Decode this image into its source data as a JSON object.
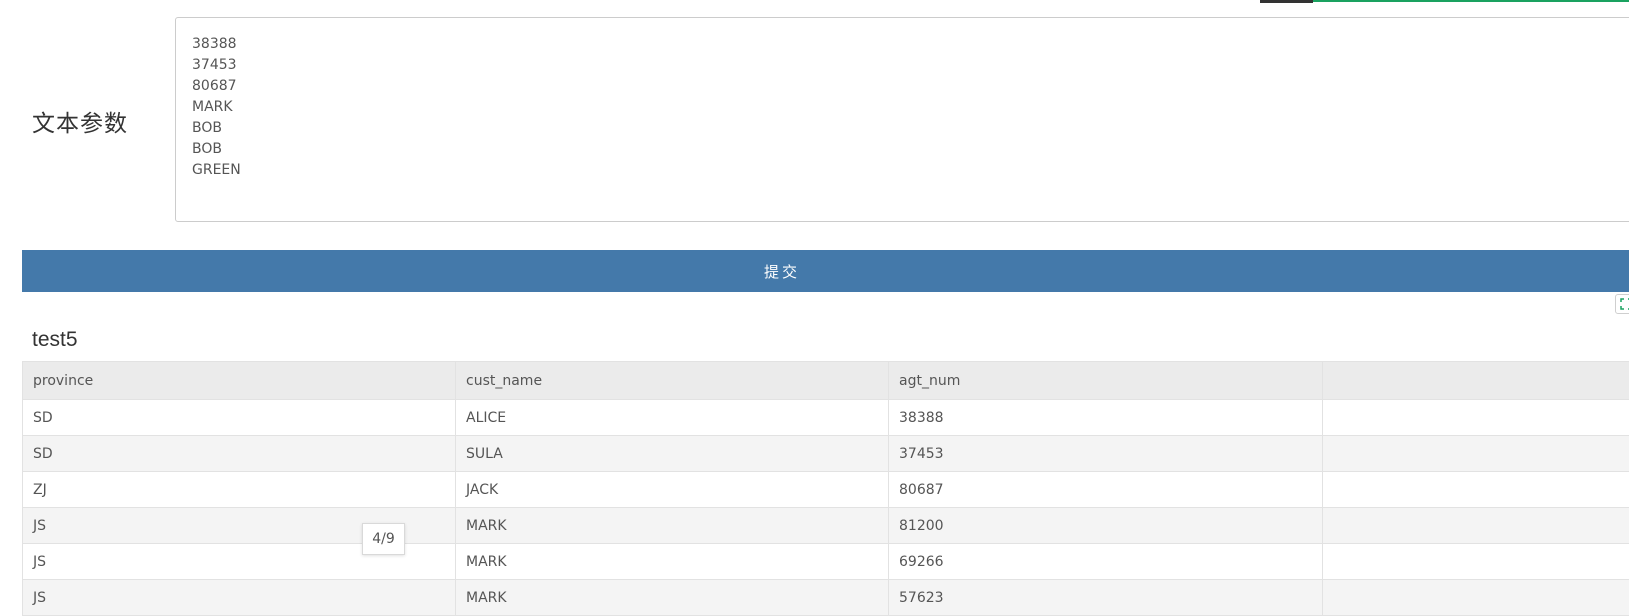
{
  "form": {
    "param_label": "文本参数",
    "textarea_value": "38388\n37453\n80687\nMARK\nBOB\nBOB\nGREEN",
    "submit_label": "提交"
  },
  "report": {
    "title": "test5",
    "columns": [
      "province",
      "cust_name",
      "agt_num",
      ""
    ],
    "rows": [
      [
        "SD",
        "ALICE",
        "38388",
        ""
      ],
      [
        "SD",
        "SULA",
        "37453",
        ""
      ],
      [
        "ZJ",
        "JACK",
        "80687",
        ""
      ],
      [
        "JS",
        "MARK",
        "81200",
        ""
      ],
      [
        "JS",
        "MARK",
        "69266",
        ""
      ],
      [
        "JS",
        "MARK",
        "57623",
        ""
      ]
    ],
    "page_indicator": "4/9"
  },
  "icons": {
    "expand": "expand-icon"
  },
  "colors": {
    "submit_bg": "#4479aa",
    "accent_green": "#1aa260",
    "header_bg": "#ebebeb"
  }
}
